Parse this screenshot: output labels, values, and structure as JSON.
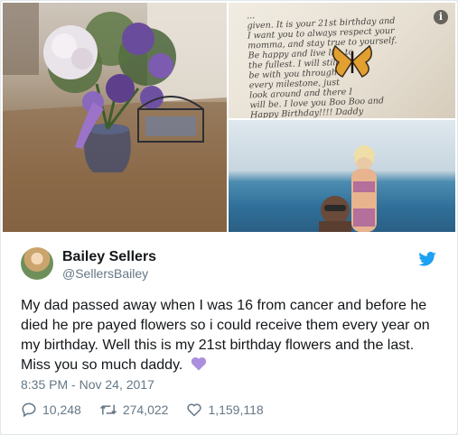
{
  "tweet": {
    "author_name": "Bailey Sellers",
    "author_handle": "@SellersBailey",
    "text": "My dad passed away when I was 16 from cancer and before he died he pre payed flowers so i could receive them every year on my birthday. Well this is my 21st birthday flowers and the last. Miss you so much daddy.",
    "timestamp": "8:35 PM - Nov 24, 2017",
    "replies": "10,248",
    "retweets": "274,022",
    "likes": "1,159,118"
  },
  "media": {
    "info_glyph": "i",
    "letter_text": "...\ngiven. It is your 21st birthday and\nI want you to always respect your\nmomma, and stay true to yourself.\nBe happy and live life to\nthe fullest. I will still\nbe with you through\nevery milestone, just\nlook around and there I\nwill be. I love you Boo Boo and\nHappy Birthday!!!! Daddy"
  },
  "colors": {
    "twitter_blue": "#1da1f2",
    "text_primary": "#14171a",
    "text_secondary": "#657786",
    "heart_purple": "#ab8fdd"
  },
  "icons": {
    "reply": "reply-icon",
    "retweet": "retweet-icon",
    "like": "like-icon",
    "twitter": "twitter-bird-icon",
    "info": "info-icon"
  }
}
